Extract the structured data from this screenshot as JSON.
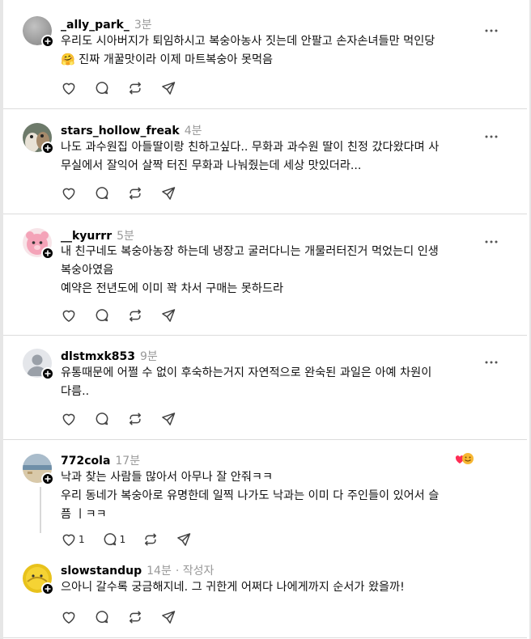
{
  "posts": [
    {
      "username": "_ally_park_",
      "time": "3분",
      "lines": [
        "우리도 시아버지가 퇴임하시고 복숭아농사 짓는데 안팔고 손자손녀들만 먹인당",
        "🤗 진짜 개꿀맛이라 이제 마트복숭아 못먹음"
      ],
      "like_count": "",
      "reply_count": ""
    },
    {
      "username": "stars_hollow_freak",
      "time": "4분",
      "lines": [
        "나도 과수원집 아들딸이랑 친하고싶다.. 무화과 과수원 딸이 친정 갔다왔다며 사",
        "무실에서 잘익어 살짝 터진 무화과 나눠줬는데 세상 맛있더라..."
      ],
      "like_count": "",
      "reply_count": ""
    },
    {
      "username": "__kyurrr",
      "time": "5분",
      "lines": [
        "내 친구네도 복숭아농장 하는데 냉장고 굴러다니는 개물러터진거 먹었는디 인생",
        "복숭아였음",
        "예약은 전년도에 이미 꽉 차서 구매는 못하드라"
      ],
      "like_count": "",
      "reply_count": ""
    },
    {
      "username": "dlstmxk853",
      "time": "9분",
      "lines": [
        "유통때문에 어쩔 수 없이 후숙하는거지 자연적으로 완숙된 과일은 아예 차원이",
        "다름.."
      ],
      "like_count": "",
      "reply_count": ""
    },
    {
      "username": "772cola",
      "time": "17분",
      "lines": [
        "낙과 찾는 사람들 많아서 아무나 잘 안줘ㅋㅋ",
        "우리 동네가 복숭아로 유명한데 일찍 나가도 낙과는 이미 다 주인들이 있어서 슬",
        "픔 ㅣㅋㅋ"
      ],
      "like_count": "1",
      "reply_count": "1"
    },
    {
      "username": "slowstandup",
      "time": "14분",
      "author_tag": "· 작성자",
      "lines": [
        "으아니 갈수록 궁금해지네. 그 귀한게 어쩌다 나에게까지 순서가 왔을까!"
      ],
      "like_count": "",
      "reply_count": ""
    }
  ],
  "icons": {
    "like": "heart-icon",
    "reply": "comment-icon",
    "repost": "repost-icon",
    "share": "send-icon",
    "more": "more-icon",
    "follow": "plus-icon"
  },
  "colors": {
    "text": "#111111",
    "muted": "#999999",
    "divider": "#dcdcdc",
    "icon": "#424242"
  }
}
